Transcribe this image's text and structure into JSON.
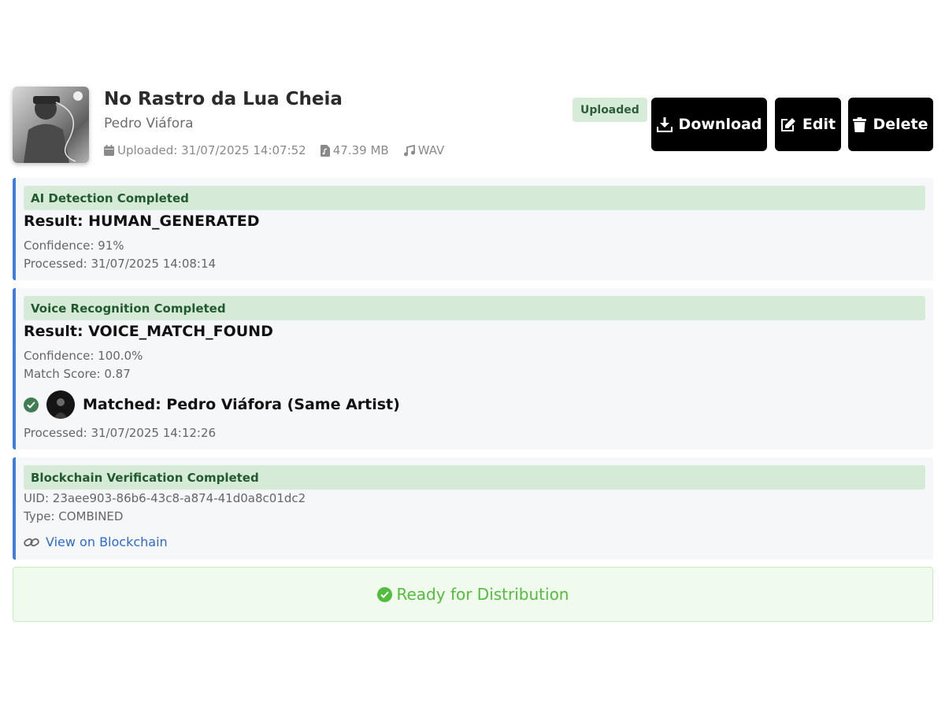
{
  "track": {
    "title": "No Rastro da Lua Cheia",
    "artist": "Pedro Viáfora",
    "uploaded": "Uploaded: 31/07/2025 14:07:52",
    "size": "47.39 MB",
    "format": "WAV",
    "status_badge": "Uploaded"
  },
  "actions": {
    "download": "Download",
    "edit": "Edit",
    "delete": "Delete"
  },
  "ai_detection": {
    "header": "AI Detection Completed",
    "result": "Result: HUMAN_GENERATED",
    "confidence": "Confidence: 91%",
    "processed": "Processed: 31/07/2025 14:08:14"
  },
  "voice_recognition": {
    "header": "Voice Recognition Completed",
    "result": "Result: VOICE_MATCH_FOUND",
    "confidence": "Confidence: 100.0%",
    "match_score": "Match Score: 0.87",
    "matched": "Matched: Pedro Viáfora (Same Artist)",
    "processed": "Processed: 31/07/2025 14:12:26"
  },
  "blockchain": {
    "header": "Blockchain Verification Completed",
    "uid": "UID: 23aee903-86b6-43c8-a874-41d0a8c01dc2",
    "type": "Type: COMBINED",
    "link": "View on Blockchain"
  },
  "ready": {
    "label": "Ready for Distribution"
  },
  "colors": {
    "accent_border": "#3f7de0",
    "success_green": "#52bc3f",
    "header_green_bg": "#d6ebd7",
    "button_bg": "#000000",
    "link_blue": "#2c6bd0"
  },
  "icons": {
    "calendar": "calendar-icon",
    "file": "file-audio-icon",
    "music": "music-note-icon",
    "download": "download-icon",
    "edit": "edit-icon",
    "delete": "trash-icon",
    "check": "check-circle-icon",
    "link": "link-icon"
  }
}
